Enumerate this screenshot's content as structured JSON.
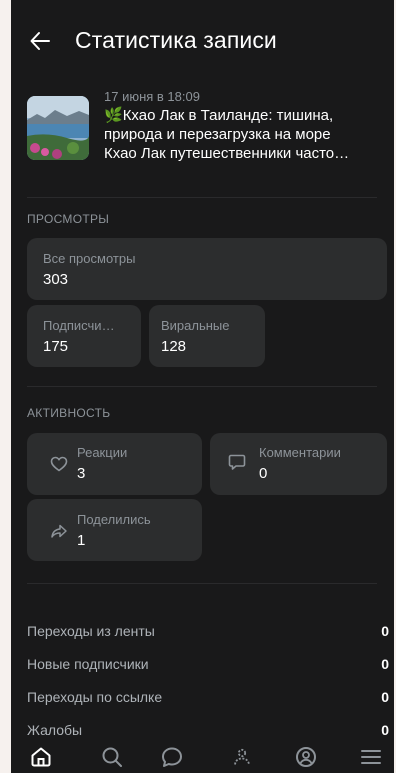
{
  "header": {
    "title": "Статистика записи"
  },
  "post": {
    "date": "17 июня в 18:09",
    "emoji": "🌿",
    "line1": "Кхао Лак в Таиланде: тишина,",
    "line2": "природа и перезагрузка на море",
    "line3": "Кхао Лак путешественники часто…"
  },
  "views": {
    "section_title": "ПРОСМОТРЫ",
    "all_label": "Все просмотры",
    "all_value": "303",
    "subs_label": "Подписчи…",
    "subs_value": "175",
    "viral_label": "Виральные",
    "viral_value": "128"
  },
  "activity": {
    "section_title": "АКТИВНОСТЬ",
    "reactions_label": "Реакции",
    "reactions_value": "3",
    "comments_label": "Комментарии",
    "comments_value": "0",
    "shares_label": "Поделились",
    "shares_value": "1"
  },
  "stats_rows": [
    {
      "label": "Переходы из ленты",
      "value": "0"
    },
    {
      "label": "Новые подписчики",
      "value": "0"
    },
    {
      "label": "Переходы по ссылке",
      "value": "0"
    },
    {
      "label": "Жалобы",
      "value": "0"
    }
  ],
  "tabbar": [
    "home-icon",
    "search-icon",
    "messages-icon",
    "friends-icon",
    "profile-icon",
    "menu-icon"
  ]
}
